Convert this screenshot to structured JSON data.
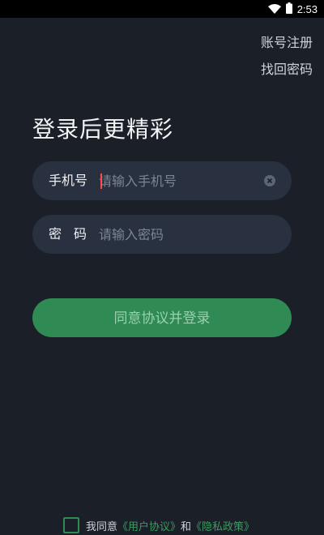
{
  "status_bar": {
    "time": "2:53"
  },
  "top_links": {
    "register": "账号注册",
    "forgot_password": "找回密码"
  },
  "headline": "登录后更精彩",
  "phone_field": {
    "label": "手机号",
    "placeholder": "请输入手机号"
  },
  "password_field": {
    "label": "密码",
    "placeholder": "请输入密码"
  },
  "login_button": {
    "label": "同意协议并登录"
  },
  "agreement": {
    "prefix": "我同意",
    "user_agreement": "《用户协议》",
    "conjunction": "和",
    "privacy_policy": "《隐私政策》"
  },
  "colors": {
    "background": "#1b1f28",
    "field": "#293140",
    "accent": "#2f8a54"
  }
}
